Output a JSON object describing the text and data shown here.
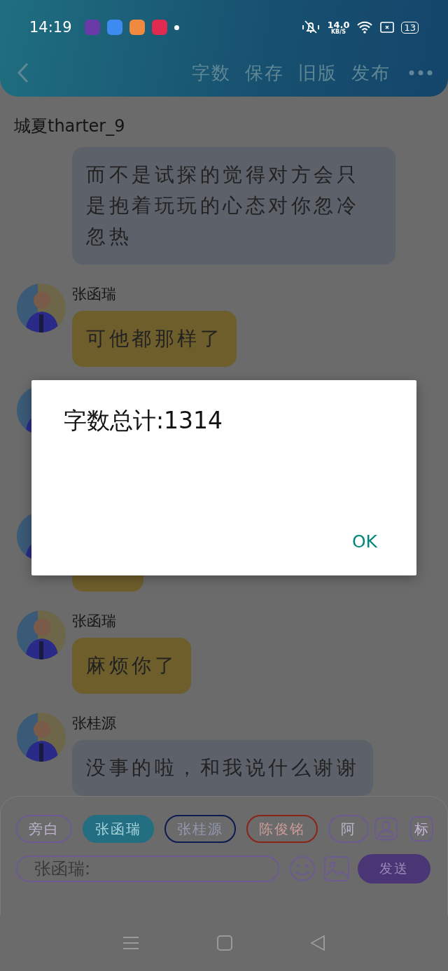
{
  "status_bar": {
    "time": "14:19",
    "net_speed": "14.0",
    "net_unit": "KB/S",
    "battery": "13"
  },
  "header": {
    "actions": [
      "字数",
      "保存",
      "旧版",
      "发布"
    ]
  },
  "title": "城夏tharter_9",
  "messages": [
    {
      "kind": "continuation",
      "text": "而不是试探的觉得对方会只是抱着玩玩的心态对你忽冷忽热",
      "color": "#5d626a"
    },
    {
      "kind": "message",
      "sender": "张函瑞",
      "text": "可他都那样了",
      "color": "#6e5e2c"
    },
    {
      "kind": "obscured"
    },
    {
      "kind": "obscured",
      "color": "#6e5e2c"
    },
    {
      "kind": "message",
      "sender": "张函瑞",
      "text": "麻烦你了",
      "color": "#6e5e2c"
    },
    {
      "kind": "message",
      "sender": "张桂源",
      "text": "没事的啦，和我说什么谢谢",
      "color": "#5d626a"
    }
  ],
  "dialog": {
    "message": "字数总计:1314",
    "button": "OK"
  },
  "composer": {
    "chips": [
      {
        "label": "旁白",
        "color": "#6c5a90",
        "selected": false
      },
      {
        "label": "张函瑞",
        "color": "#236e80",
        "selected": true
      },
      {
        "label": "张桂源",
        "color": "#0e1a50",
        "selected": false
      },
      {
        "label": "陈俊铭",
        "color": "#8a2418",
        "selected": false
      },
      {
        "label": "阿",
        "color": "#6c5a90",
        "selected": false
      }
    ],
    "mark_button": "标",
    "input": {
      "value": "张函瑞:"
    },
    "send_button": "发送"
  }
}
